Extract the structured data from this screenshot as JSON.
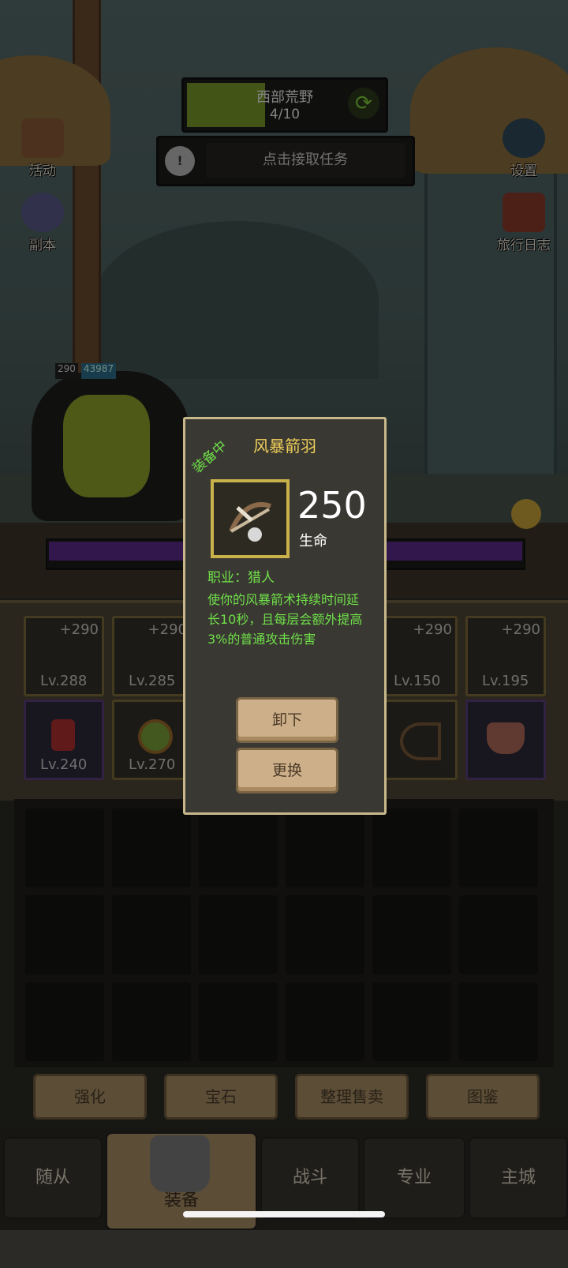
{
  "hud": {
    "region_name": "西部荒野",
    "region_progress": "4/10",
    "region_progress_value": 0.4,
    "task_prompt": "点击接取任务"
  },
  "side_left": [
    {
      "label": "活动",
      "icon": "calendar-icon"
    },
    {
      "label": "副本",
      "icon": "portal-icon"
    }
  ],
  "side_right": [
    {
      "label": "设置",
      "icon": "gear-icon"
    },
    {
      "label": "旅行日志",
      "icon": "journal-icon"
    }
  ],
  "player": {
    "level": "290",
    "hp": "43987"
  },
  "equipment": {
    "row1": [
      {
        "plus": "+290",
        "level": "Lv.288",
        "icon": "helmet-icon"
      },
      {
        "plus": "+290",
        "level": "Lv.285",
        "icon": "armor-icon"
      },
      {
        "plus": "+290",
        "level": "Lv.150",
        "icon": "crossbow-icon"
      },
      {
        "plus": "+290",
        "level": "Lv.195",
        "icon": "bow-icon"
      }
    ],
    "row2": [
      {
        "level": "Lv.240",
        "icon": "boots-icon"
      },
      {
        "level": "Lv.270",
        "icon": "ring-icon"
      },
      {
        "level": "",
        "icon": "arrow-quiver-icon"
      },
      {
        "level": "",
        "icon": "shield-icon"
      }
    ]
  },
  "actions": [
    "强化",
    "宝石",
    "整理售卖",
    "图鉴"
  ],
  "tabs": [
    "随从",
    "装备",
    "战斗",
    "专业",
    "主城"
  ],
  "popup": {
    "title": "风暴箭羽",
    "equipped_tag": "装备中",
    "stat_value": "250",
    "stat_label": "生命",
    "class_line": "职业：猎人",
    "description": "使你的风暴箭术持续时间延长10秒，且每层会额外提高3%的普通攻击伤害",
    "unequip_label": "卸下",
    "replace_label": "更换"
  },
  "colors": {
    "accent_green": "#6fe04a",
    "title_gold": "#f0d05a",
    "frame_gold": "#c9b24a"
  }
}
